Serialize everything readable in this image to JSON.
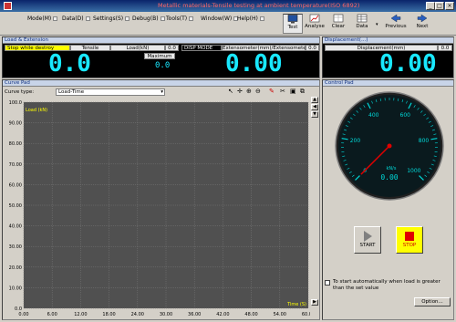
{
  "window": {
    "title": "Metallic materials-Tensile testing at ambient temperature(ISO 6892)"
  },
  "menu": {
    "items": [
      "Mode(M)",
      "Data(D)",
      "Settings(S)",
      "Debug(B)",
      "Tools(T)",
      "Window(W)",
      "Help(H)"
    ]
  },
  "toolbar": {
    "test_label": "Test",
    "analyse_label": "Analyse",
    "clear_label": "Clear",
    "data_label": "Data",
    "previous_label": "Previous",
    "next_label": "Next"
  },
  "load_panel": {
    "title": "Load & Extension",
    "mode_label": "Stop while destroy",
    "tensile_label": "Tensile",
    "load_header": "Load(kN)",
    "load_zero": "0.0",
    "load_value": "0.0",
    "maximum_label": "Maximum",
    "maximum_value": "0.0",
    "disp_mode_label": "DISP MODE",
    "extenso_header": "Extensometer(mm)/Extensometer",
    "extenso_zero": "0.0",
    "extenso_value": "0.00"
  },
  "displacement_panel": {
    "title": "Displacement(...)",
    "header": "Displacement(mm)",
    "zero": "0.0",
    "value": "0.00"
  },
  "curve_pad": {
    "title": "Curve Pad",
    "curve_type_label": "Curve type:",
    "curve_type_value": "Load-Time"
  },
  "control_pad": {
    "title": "Control Pad",
    "gauge_unit": "kN/s",
    "gauge_value": "0.00",
    "start_label": "START",
    "stop_label": "STOP",
    "auto_start_text": "To start automatically when load is greater than the set value",
    "option_label": "Option..."
  },
  "chart_data": {
    "type": "line",
    "ylabel": "Load (kN)",
    "xlabel": "Time (S)",
    "xlim": [
      0,
      60
    ],
    "ylim": [
      0,
      100
    ],
    "x_ticks": [
      "0.00",
      "6.00",
      "12.00",
      "18.00",
      "24.00",
      "30.00",
      "36.00",
      "42.00",
      "48.00",
      "54.00",
      "60.00"
    ],
    "y_ticks": [
      "100.0",
      "90.00",
      "80.00",
      "70.00",
      "60.00",
      "50.00",
      "40.00",
      "30.00",
      "20.00",
      "10.00",
      "0.0"
    ],
    "series": [],
    "grid": true,
    "colors": {
      "background": "#505050",
      "grid": "#7a7a7a",
      "label": "#ffff00"
    }
  },
  "gauge_data": {
    "ticks": [
      "0",
      "200",
      "400",
      "600",
      "800",
      "1000"
    ],
    "min": 0,
    "max": 1000,
    "value": 0,
    "needle_color": "#e00000",
    "face_color": "#0a1a1e",
    "tick_color": "#00d8d8"
  }
}
